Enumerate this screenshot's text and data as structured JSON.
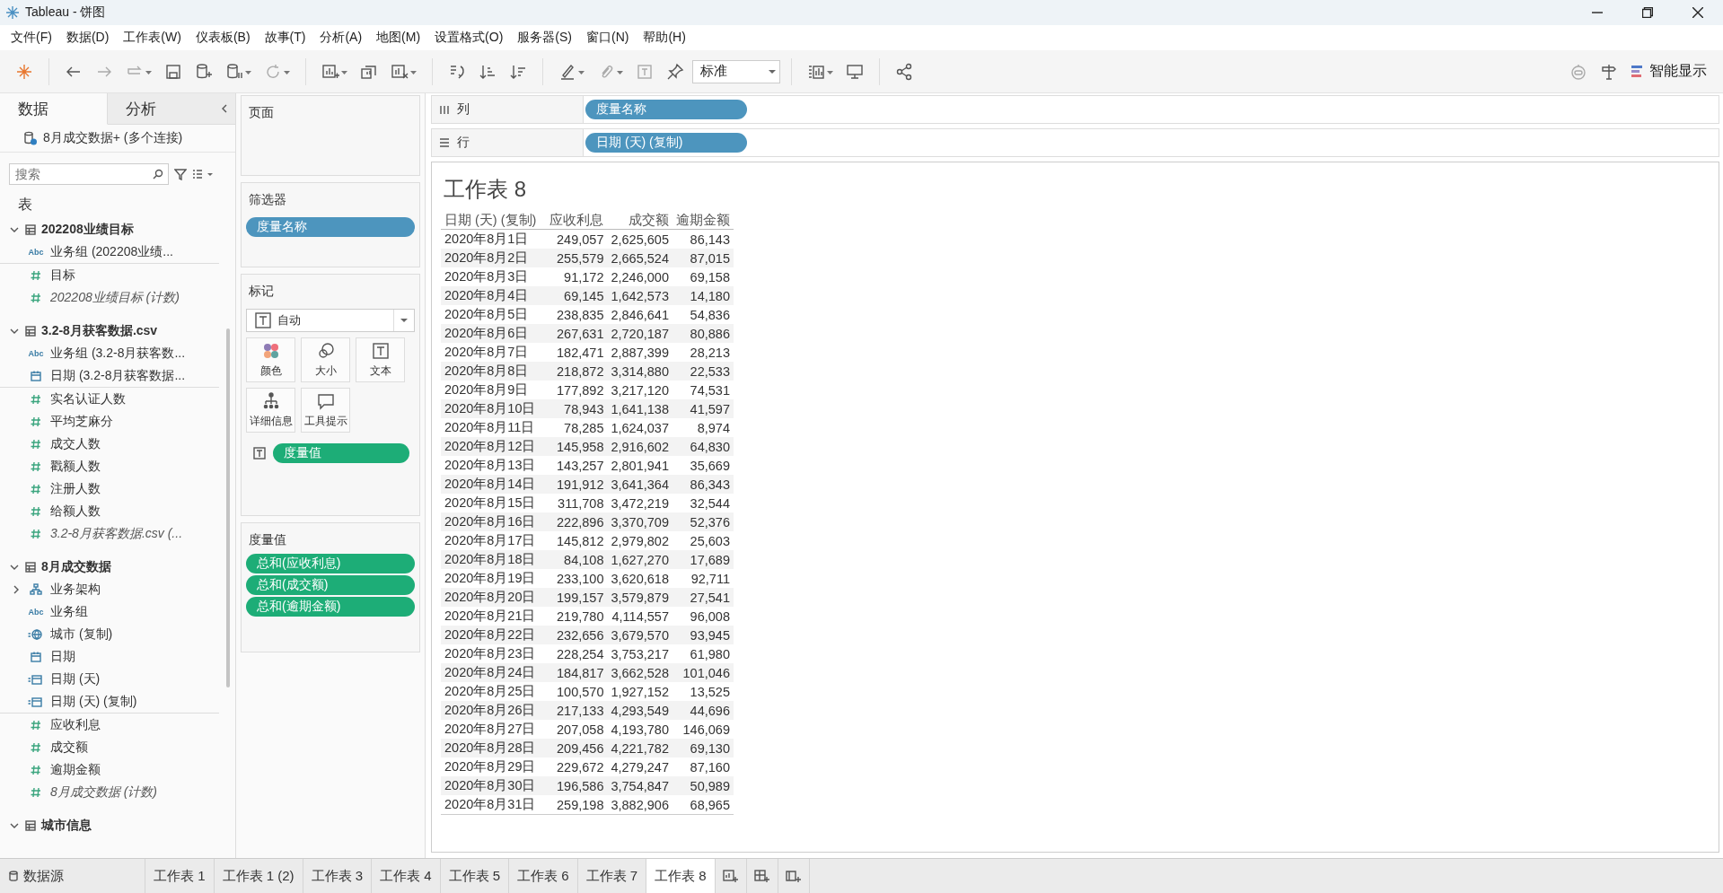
{
  "window": {
    "title": "Tableau - 饼图"
  },
  "menu": [
    "文件(F)",
    "数据(D)",
    "工作表(W)",
    "仪表板(B)",
    "故事(T)",
    "分析(A)",
    "地图(M)",
    "设置格式(O)",
    "服务器(S)",
    "窗口(N)",
    "帮助(H)"
  ],
  "toolbar": {
    "fit": "标准",
    "show_me": "智能显示"
  },
  "side_tabs": [
    {
      "label": "数据",
      "selected": true
    },
    {
      "label": "分析",
      "selected": false
    }
  ],
  "data_source": "8月成交数据+ (多个连接)",
  "search": {
    "placeholder": "搜索"
  },
  "tables_heading": "表",
  "tables": [
    {
      "name": "202208业绩目标",
      "expanded": true,
      "fields": [
        {
          "kind": "string",
          "type_badge": "Abc",
          "name": "业务组 (202208业绩..."
        },
        {
          "kind": "measure",
          "name": "目标"
        },
        {
          "kind": "count",
          "name": "202208业绩目标 (计数)"
        }
      ]
    },
    {
      "name": "3.2-8月获客数据.csv",
      "expanded": true,
      "fields": [
        {
          "kind": "string",
          "type_badge": "Abc",
          "name": "业务组 (3.2-8月获客数..."
        },
        {
          "kind": "date",
          "name": "日期 (3.2-8月获客数据..."
        },
        {
          "kind": "measure",
          "name": "实名认证人数"
        },
        {
          "kind": "measure",
          "name": "平均芝麻分"
        },
        {
          "kind": "measure",
          "name": "成交人数"
        },
        {
          "kind": "measure",
          "name": "戳额人数"
        },
        {
          "kind": "measure",
          "name": "注册人数"
        },
        {
          "kind": "measure",
          "name": "给额人数"
        },
        {
          "kind": "count",
          "name": "3.2-8月获客数据.csv (..."
        }
      ]
    },
    {
      "name": "8月成交数据",
      "expanded": true,
      "fields": [
        {
          "kind": "hierarchy",
          "name": "业务架构",
          "expanded": false
        },
        {
          "kind": "string",
          "type_badge": "Abc",
          "name": "业务组"
        },
        {
          "kind": "geo",
          "name": "城市 (复制)"
        },
        {
          "kind": "date",
          "name": "日期"
        },
        {
          "kind": "date-calc",
          "name": "日期 (天)"
        },
        {
          "kind": "date-calc",
          "name": "日期 (天) (复制)"
        },
        {
          "kind": "measure",
          "name": "应收利息"
        },
        {
          "kind": "measure",
          "name": "成交额"
        },
        {
          "kind": "measure",
          "name": "逾期金额"
        },
        {
          "kind": "count",
          "name": "8月成交数据 (计数)"
        }
      ]
    },
    {
      "name": "城市信息",
      "expanded": true
    }
  ],
  "pages": {
    "label": "页面"
  },
  "filters": {
    "label": "筛选器",
    "pills": [
      {
        "text": "度量名称",
        "kind": "dimension"
      }
    ]
  },
  "marks": {
    "label": "标记",
    "mark_type": "自动",
    "buttons": [
      {
        "label": "颜色",
        "kind": "color"
      },
      {
        "label": "大小",
        "kind": "size"
      },
      {
        "label": "文本",
        "kind": "text"
      },
      {
        "label": "详细信息",
        "kind": "detail"
      },
      {
        "label": "工具提示",
        "kind": "tooltip"
      }
    ],
    "pills": [
      {
        "text": "度量值",
        "kind": "measure"
      }
    ]
  },
  "measure_values": {
    "label": "度量值",
    "pills": [
      {
        "text": "总和(应收利息)",
        "kind": "measure"
      },
      {
        "text": "总和(成交额)",
        "kind": "measure"
      },
      {
        "text": "总和(逾期金额)",
        "kind": "measure"
      }
    ]
  },
  "shelves": [
    {
      "kind": "columns",
      "label": "列",
      "pills": [
        {
          "text": "度量名称",
          "kind": "dimension"
        }
      ]
    },
    {
      "kind": "rows",
      "label": "行",
      "pills": [
        {
          "text": "日期 (天) (复制)",
          "kind": "dimension"
        }
      ]
    }
  ],
  "sheet": {
    "title": "工作表 8",
    "columns": [
      "日期 (天) (复制)",
      "应收利息",
      "成交额",
      "逾期金额"
    ],
    "rows": [
      [
        "2020年8月1日",
        "249,057",
        "2,625,605",
        "86,143"
      ],
      [
        "2020年8月2日",
        "255,579",
        "2,665,524",
        "87,015"
      ],
      [
        "2020年8月3日",
        "91,172",
        "2,246,000",
        "69,158"
      ],
      [
        "2020年8月4日",
        "69,145",
        "1,642,573",
        "14,180"
      ],
      [
        "2020年8月5日",
        "238,835",
        "2,846,641",
        "54,836"
      ],
      [
        "2020年8月6日",
        "267,631",
        "2,720,187",
        "80,886"
      ],
      [
        "2020年8月7日",
        "182,471",
        "2,887,399",
        "28,213"
      ],
      [
        "2020年8月8日",
        "218,872",
        "3,314,880",
        "22,533"
      ],
      [
        "2020年8月9日",
        "177,892",
        "3,217,120",
        "74,531"
      ],
      [
        "2020年8月10日",
        "78,943",
        "1,641,138",
        "41,597"
      ],
      [
        "2020年8月11日",
        "78,285",
        "1,624,037",
        "8,974"
      ],
      [
        "2020年8月12日",
        "145,958",
        "2,916,602",
        "64,830"
      ],
      [
        "2020年8月13日",
        "143,257",
        "2,801,941",
        "35,669"
      ],
      [
        "2020年8月14日",
        "191,912",
        "3,641,364",
        "86,343"
      ],
      [
        "2020年8月15日",
        "311,708",
        "3,472,219",
        "32,544"
      ],
      [
        "2020年8月16日",
        "222,896",
        "3,370,709",
        "52,376"
      ],
      [
        "2020年8月17日",
        "145,812",
        "2,979,802",
        "25,603"
      ],
      [
        "2020年8月18日",
        "84,108",
        "1,627,270",
        "17,689"
      ],
      [
        "2020年8月19日",
        "233,100",
        "3,620,618",
        "92,711"
      ],
      [
        "2020年8月20日",
        "199,157",
        "3,579,879",
        "27,541"
      ],
      [
        "2020年8月21日",
        "219,780",
        "4,114,557",
        "96,008"
      ],
      [
        "2020年8月22日",
        "232,656",
        "3,679,570",
        "93,945"
      ],
      [
        "2020年8月23日",
        "228,254",
        "3,753,217",
        "61,980"
      ],
      [
        "2020年8月24日",
        "184,817",
        "3,662,528",
        "101,046"
      ],
      [
        "2020年8月25日",
        "100,570",
        "1,927,152",
        "13,525"
      ],
      [
        "2020年8月26日",
        "217,133",
        "4,293,549",
        "44,696"
      ],
      [
        "2020年8月27日",
        "207,058",
        "4,193,780",
        "146,069"
      ],
      [
        "2020年8月28日",
        "209,456",
        "4,221,782",
        "69,130"
      ],
      [
        "2020年8月29日",
        "229,672",
        "4,279,247",
        "87,160"
      ],
      [
        "2020年8月30日",
        "196,586",
        "3,754,847",
        "50,989"
      ],
      [
        "2020年8月31日",
        "259,198",
        "3,882,906",
        "68,965"
      ]
    ]
  },
  "bottom_tabs": [
    {
      "label": "数据源",
      "kind": "datasource",
      "selected": false
    },
    {
      "label": "工作表 1",
      "kind": "sheet",
      "selected": false
    },
    {
      "label": "工作表 1 (2)",
      "kind": "sheet",
      "selected": false
    },
    {
      "label": "工作表 3",
      "kind": "sheet",
      "selected": false
    },
    {
      "label": "工作表 4",
      "kind": "sheet",
      "selected": false
    },
    {
      "label": "工作表 5",
      "kind": "sheet",
      "selected": false
    },
    {
      "label": "工作表 6",
      "kind": "sheet",
      "selected": false
    },
    {
      "label": "工作表 7",
      "kind": "sheet",
      "selected": false
    },
    {
      "label": "工作表 8",
      "kind": "sheet",
      "selected": true
    }
  ]
}
